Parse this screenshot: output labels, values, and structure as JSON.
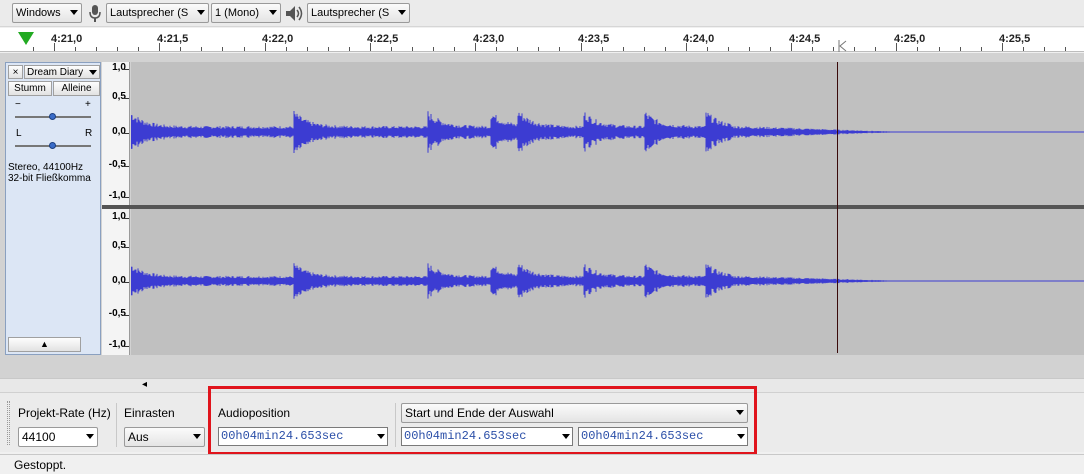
{
  "device_toolbar": {
    "host": "Windows",
    "recording_device": "Lautsprecher (S",
    "channels": "1 (Mono)",
    "playback_device": "Lautsprecher (S"
  },
  "ruler": {
    "labels": [
      "4:21,0",
      "4:21,5",
      "4:22,0",
      "4:22,5",
      "4:23,0",
      "4:23,5",
      "4:24,0",
      "4:24,5",
      "4:25,0",
      "4:25,5"
    ]
  },
  "track": {
    "name": "Dream Diary",
    "close": "×",
    "mute": "Stumm",
    "solo": "Alleine",
    "gain_minus": "−",
    "gain_plus": "+",
    "pan_left": "L",
    "pan_right": "R",
    "info_line1": "Stereo, 44100Hz",
    "info_line2": "32-bit Fließkomma",
    "collapse": "▲"
  },
  "vertical_ruler": {
    "labels": [
      "1,0",
      "0,5",
      "0,0",
      "-0,5",
      "-1,0"
    ]
  },
  "colors": {
    "waveform": "#3c3cd2",
    "selection_highlight": "#e0141c",
    "play_indicator": "#22aa22"
  },
  "selection_toolbar": {
    "project_rate_label": "Projekt-Rate (Hz)",
    "project_rate_value": "44100",
    "snap_label": "Einrasten",
    "snap_value": "Aus",
    "audio_position_label": "Audioposition",
    "selection_mode": "Start und Ende der Auswahl",
    "audio_position": {
      "h": "00",
      "min": "04",
      "sec": "24.653"
    },
    "selection_start": {
      "h": "00",
      "min": "04",
      "sec": "24.653"
    },
    "selection_end": {
      "h": "00",
      "min": "04",
      "sec": "24.653"
    },
    "unit_h": "h",
    "unit_min": "min",
    "unit_sec": "sec"
  },
  "status": {
    "text": "Gestoppt."
  },
  "scroll": {
    "left_arrow": "◂"
  }
}
